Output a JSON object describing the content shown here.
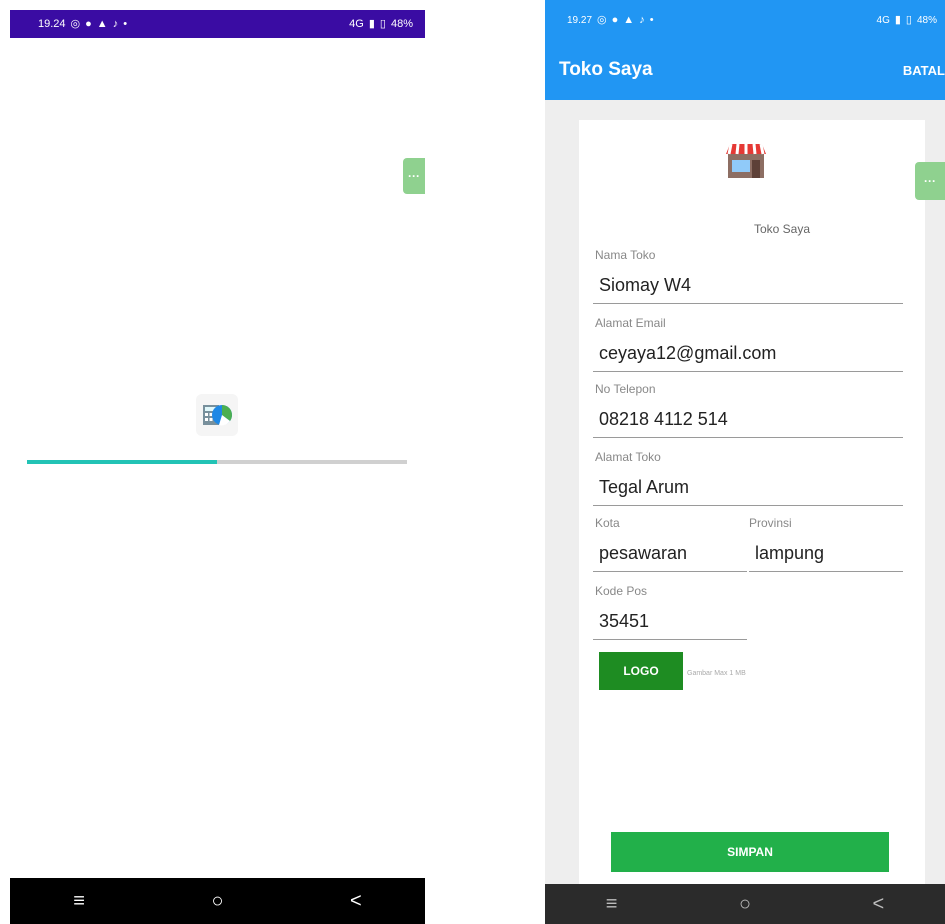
{
  "left_screen": {
    "status_bar": {
      "time": "19.24",
      "signal": "4G",
      "battery": "48%"
    },
    "float_button": "···",
    "progress": 0.5,
    "nav": {
      "menu": "≡",
      "home": "○",
      "back": "<"
    }
  },
  "right_screen": {
    "status_bar": {
      "time": "19.27",
      "signal": "4G",
      "battery": "48%"
    },
    "appbar": {
      "title": "Toko Saya",
      "action": "BATAL"
    },
    "float_button": "···",
    "header_label": "Toko Saya",
    "fields": {
      "nama_toko": {
        "label": "Nama Toko",
        "value": "Siomay W4"
      },
      "email": {
        "label": "Alamat Email",
        "value": "ceyaya12@gmail.com"
      },
      "telepon": {
        "label": "No Telepon",
        "value": "08218 4112 514"
      },
      "alamat": {
        "label": "Alamat Toko",
        "value": "Tegal Arum"
      },
      "kota": {
        "label": "Kota",
        "value": "pesawaran"
      },
      "provinsi": {
        "label": "Provinsi",
        "value": "lampung"
      },
      "kode_pos": {
        "label": "Kode Pos",
        "value": "35451"
      }
    },
    "logo_button": "LOGO",
    "logo_hint": "Gambar Max 1 MB",
    "save_button": "SIMPAN",
    "nav": {
      "menu": "≡",
      "home": "○",
      "back": "<"
    }
  },
  "colors": {
    "left_status": "#3a0ca3",
    "app_blue": "#2196f3",
    "progress": "#22c3b5",
    "logo_btn": "#1e8c22",
    "save_btn": "#22b04a"
  }
}
